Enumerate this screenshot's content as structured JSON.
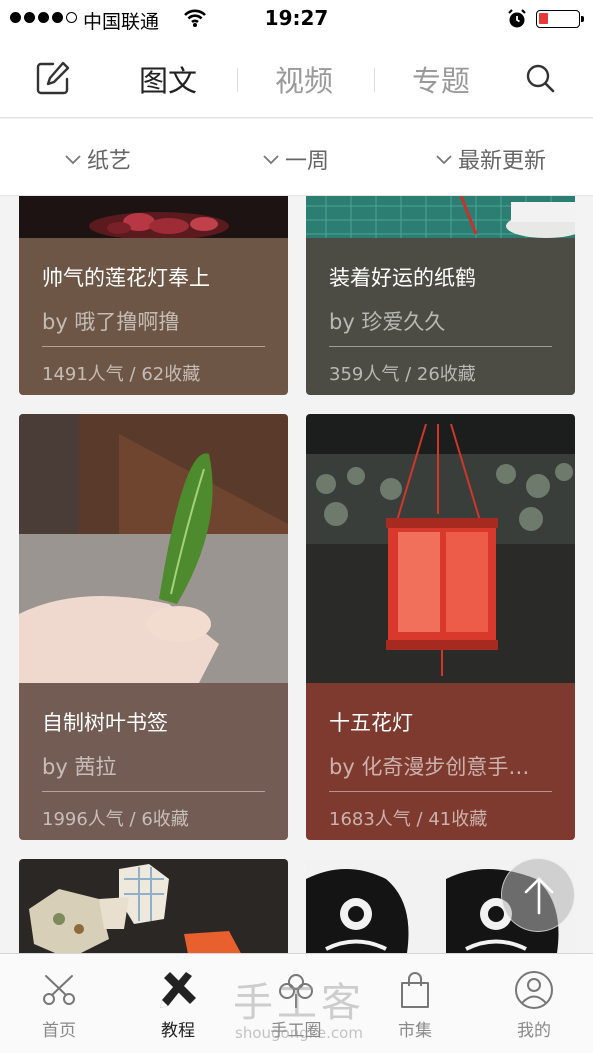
{
  "status_bar": {
    "carrier": "中国联通",
    "time": "19:27"
  },
  "top_nav": {
    "edit_icon": "edit-icon",
    "tabs": [
      {
        "label": "图文",
        "active": true
      },
      {
        "label": "视频",
        "active": false
      },
      {
        "label": "专题",
        "active": false
      }
    ],
    "search_icon": "search-icon"
  },
  "filters": [
    {
      "label": "纸艺",
      "icon": "chevron-down-icon"
    },
    {
      "label": "一周",
      "icon": "chevron-down-icon"
    },
    {
      "label": "最新更新",
      "icon": "chevron-down-icon"
    }
  ],
  "cards": [
    {
      "title": "帅气的莲花灯奉上",
      "author": "by 哦了撸啊撸",
      "stats": "1491人气 / 62收藏",
      "color": "#6e5646"
    },
    {
      "title": "装着好运的纸鹤",
      "author": "by 珍爱久久",
      "stats": "359人气 / 26收藏",
      "color": "#4c4c45"
    },
    {
      "title": "自制树叶书签",
      "author": "by 茜拉",
      "stats": "1996人气 / 6收藏",
      "color": "#735c54"
    },
    {
      "title": "十五花灯",
      "author": "by 化奇漫步创意手…",
      "stats": "1683人气 / 41收藏",
      "color": "#7e3a2e"
    }
  ],
  "scroll_top_icon": "arrow-up-icon",
  "tab_bar": [
    {
      "label": "首页",
      "icon": "scissors-icon",
      "active": false
    },
    {
      "label": "教程",
      "icon": "pencil-ruler-icon",
      "active": true
    },
    {
      "label": "手工圈",
      "icon": "flower-icon",
      "active": false
    },
    {
      "label": "市集",
      "icon": "shopping-bag-icon",
      "active": false
    },
    {
      "label": "我的",
      "icon": "user-icon",
      "active": false
    }
  ],
  "watermark": {
    "text": "手工客",
    "url": "shougongke.com"
  }
}
